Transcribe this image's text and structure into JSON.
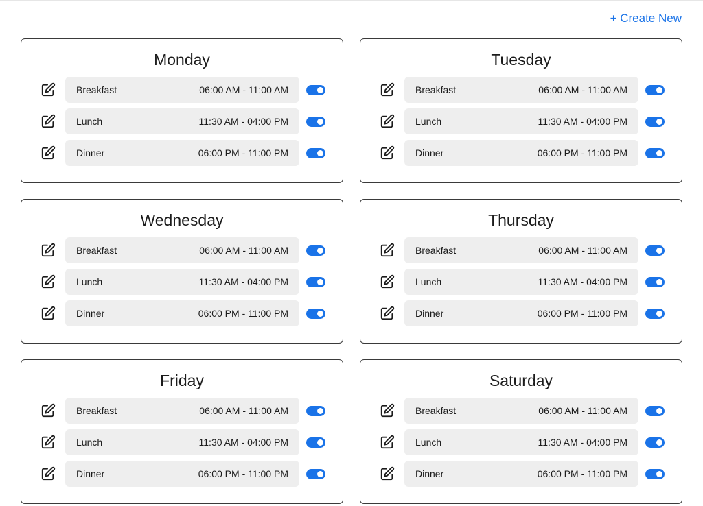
{
  "header": {
    "create_new_label": "+ Create New"
  },
  "colors": {
    "accent": "#1a73e8",
    "pill_bg": "#eeeeee",
    "card_border": "#3a3a3a"
  },
  "days": [
    {
      "name": "Monday",
      "meals": [
        {
          "label": "Breakfast",
          "time": "06:00 AM - 11:00 AM",
          "enabled": true
        },
        {
          "label": "Lunch",
          "time": "11:30 AM - 04:00 PM",
          "enabled": true
        },
        {
          "label": "Dinner",
          "time": "06:00 PM - 11:00 PM",
          "enabled": true
        }
      ]
    },
    {
      "name": "Tuesday",
      "meals": [
        {
          "label": "Breakfast",
          "time": "06:00 AM - 11:00 AM",
          "enabled": true
        },
        {
          "label": "Lunch",
          "time": "11:30 AM - 04:00 PM",
          "enabled": true
        },
        {
          "label": "Dinner",
          "time": "06:00 PM - 11:00 PM",
          "enabled": true
        }
      ]
    },
    {
      "name": "Wednesday",
      "meals": [
        {
          "label": "Breakfast",
          "time": "06:00 AM - 11:00 AM",
          "enabled": true
        },
        {
          "label": "Lunch",
          "time": "11:30 AM - 04:00 PM",
          "enabled": true
        },
        {
          "label": "Dinner",
          "time": "06:00 PM - 11:00 PM",
          "enabled": true
        }
      ]
    },
    {
      "name": "Thursday",
      "meals": [
        {
          "label": "Breakfast",
          "time": "06:00 AM - 11:00 AM",
          "enabled": true
        },
        {
          "label": "Lunch",
          "time": "11:30 AM - 04:00 PM",
          "enabled": true
        },
        {
          "label": "Dinner",
          "time": "06:00 PM - 11:00 PM",
          "enabled": true
        }
      ]
    },
    {
      "name": "Friday",
      "meals": [
        {
          "label": "Breakfast",
          "time": "06:00 AM - 11:00 AM",
          "enabled": true
        },
        {
          "label": "Lunch",
          "time": "11:30 AM - 04:00 PM",
          "enabled": true
        },
        {
          "label": "Dinner",
          "time": "06:00 PM - 11:00 PM",
          "enabled": true
        }
      ]
    },
    {
      "name": "Saturday",
      "meals": [
        {
          "label": "Breakfast",
          "time": "06:00 AM - 11:00 AM",
          "enabled": true
        },
        {
          "label": "Lunch",
          "time": "11:30 AM - 04:00 PM",
          "enabled": true
        },
        {
          "label": "Dinner",
          "time": "06:00 PM - 11:00 PM",
          "enabled": true
        }
      ]
    }
  ]
}
